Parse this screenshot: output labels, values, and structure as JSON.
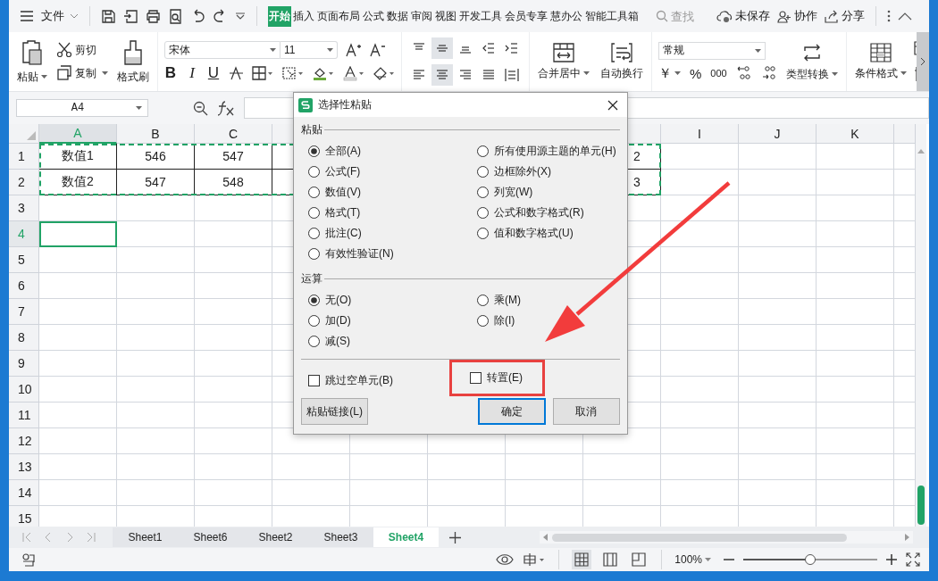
{
  "menu_bar": {
    "file_menu": "文件",
    "tabs": [
      {
        "label": "开始",
        "selected": true
      },
      {
        "label": "插入",
        "selected": false
      },
      {
        "label": "页面布局",
        "selected": false
      },
      {
        "label": "公式",
        "selected": false
      },
      {
        "label": "数据",
        "selected": false
      },
      {
        "label": "审阅",
        "selected": false
      },
      {
        "label": "视图",
        "selected": false
      },
      {
        "label": "开发工具",
        "selected": false
      },
      {
        "label": "会员专享",
        "selected": false
      },
      {
        "label": "慧办公",
        "selected": false
      },
      {
        "label": "智能工具箱",
        "selected": false
      }
    ],
    "search": {
      "placeholder": "查找"
    },
    "unsaved": "未保存",
    "collaborate": "协作",
    "share": "分享"
  },
  "ribbon": {
    "paste": "粘贴",
    "cut": "剪切",
    "copy": "复制",
    "format_painter": "格式刷",
    "font": "宋体",
    "font_size": "11",
    "bold": "B",
    "italic": "I",
    "underline": "U",
    "align_buttons": [
      {
        "kind": "top",
        "selected": false
      },
      {
        "kind": "middle",
        "selected": true
      },
      {
        "kind": "bottom",
        "selected": false
      },
      {
        "kind": "outdent",
        "selected": false
      },
      {
        "kind": "indent",
        "selected": false
      },
      {
        "kind": "left",
        "selected": false
      },
      {
        "kind": "center",
        "selected": true
      },
      {
        "kind": "right",
        "selected": false
      },
      {
        "kind": "justify",
        "selected": false
      },
      {
        "kind": "distribute",
        "selected": false
      }
    ],
    "merge_center": "合并居中",
    "wrap_text": "自动换行",
    "number_format": "常规",
    "currency": "￥",
    "percent": "%",
    "thousands": "000",
    "convert_type": "类型转换",
    "conditional_format": "条件格式"
  },
  "formula_bar": {
    "name_box": "A4"
  },
  "sheet": {
    "columns": [
      {
        "label": "A",
        "selected": true
      },
      {
        "label": "B",
        "selected": false
      },
      {
        "label": "C",
        "selected": false
      },
      {},
      {},
      {},
      {},
      {},
      {
        "label": "I",
        "selected": false
      },
      {
        "label": "J",
        "selected": false
      },
      {
        "label": "K",
        "selected": false
      }
    ],
    "rows": [
      {
        "label": "1",
        "selected": false,
        "cells": [
          {
            "text": "数值1"
          },
          {
            "text": "546"
          },
          {
            "text": "547"
          },
          {
            "kind": "covered"
          },
          {
            "kind": "covered"
          },
          {
            "kind": "covered"
          },
          {
            "kind": "covered"
          },
          {
            "text": "2",
            "kind": "clipped"
          }
        ]
      },
      {
        "label": "2",
        "selected": false,
        "cells": [
          {
            "text": "数值2"
          },
          {
            "text": "547"
          },
          {
            "text": "548"
          },
          {
            "kind": "covered"
          },
          {
            "kind": "covered"
          },
          {
            "kind": "covered"
          },
          {
            "kind": "covered"
          },
          {
            "text": "3",
            "kind": "clipped"
          }
        ]
      },
      {
        "label": "3",
        "selected": false
      },
      {
        "label": "4",
        "selected": true
      },
      {
        "label": "5",
        "selected": false
      },
      {
        "label": "6",
        "selected": false
      },
      {
        "label": "7",
        "selected": false
      },
      {
        "label": "8",
        "selected": false
      },
      {
        "label": "9",
        "selected": false
      },
      {
        "label": "10",
        "selected": false
      },
      {
        "label": "11",
        "selected": false
      },
      {
        "label": "12",
        "selected": false
      },
      {
        "label": "13",
        "selected": false
      },
      {
        "label": "14",
        "selected": false
      },
      {
        "label": "15",
        "selected": false
      }
    ]
  },
  "sheet_tabs": [
    {
      "label": "Sheet1",
      "selected": false
    },
    {
      "label": "Sheet6",
      "selected": false
    },
    {
      "label": "Sheet2",
      "selected": false
    },
    {
      "label": "Sheet3",
      "selected": false
    },
    {
      "label": "Sheet4",
      "selected": true
    }
  ],
  "status_bar": {
    "zoom": "100%",
    "zoom_level": {
      "level": 0.5
    }
  },
  "dialog": {
    "title": "选择性粘贴",
    "paste_section": {
      "label": "粘贴",
      "columns": [
        [
          {
            "label": "全部(A)",
            "selected": true
          },
          {
            "label": "公式(F)",
            "selected": false
          },
          {
            "label": "数值(V)",
            "selected": false
          },
          {
            "label": "格式(T)",
            "selected": false
          },
          {
            "label": "批注(C)",
            "selected": false
          },
          {
            "label": "有效性验证(N)",
            "selected": false
          }
        ],
        [
          {
            "label": "所有使用源主题的单元(H)",
            "selected": false
          },
          {
            "label": "边框除外(X)",
            "selected": false
          },
          {
            "label": "列宽(W)",
            "selected": false
          },
          {
            "label": "公式和数字格式(R)",
            "selected": false
          },
          {
            "label": "值和数字格式(U)",
            "selected": false
          }
        ]
      ]
    },
    "operation_section": {
      "label": "运算",
      "columns": [
        [
          {
            "label": "无(O)",
            "selected": true
          },
          {
            "label": "加(D)",
            "selected": false
          },
          {
            "label": "减(S)",
            "selected": false
          }
        ],
        [
          {
            "label": "乘(M)",
            "selected": false
          },
          {
            "label": "除(I)",
            "selected": false
          }
        ]
      ]
    },
    "checkboxes": [
      {
        "label": "跳过空单元(B)",
        "checked": false,
        "highlighted": false
      },
      {
        "label": "转置(E)",
        "checked": false,
        "highlighted": true
      }
    ],
    "buttons": [
      {
        "label": "粘贴链接(L)",
        "kind": "secondary"
      },
      {
        "label": "确定",
        "kind": "default"
      },
      {
        "label": "取消",
        "kind": "normal"
      }
    ]
  }
}
